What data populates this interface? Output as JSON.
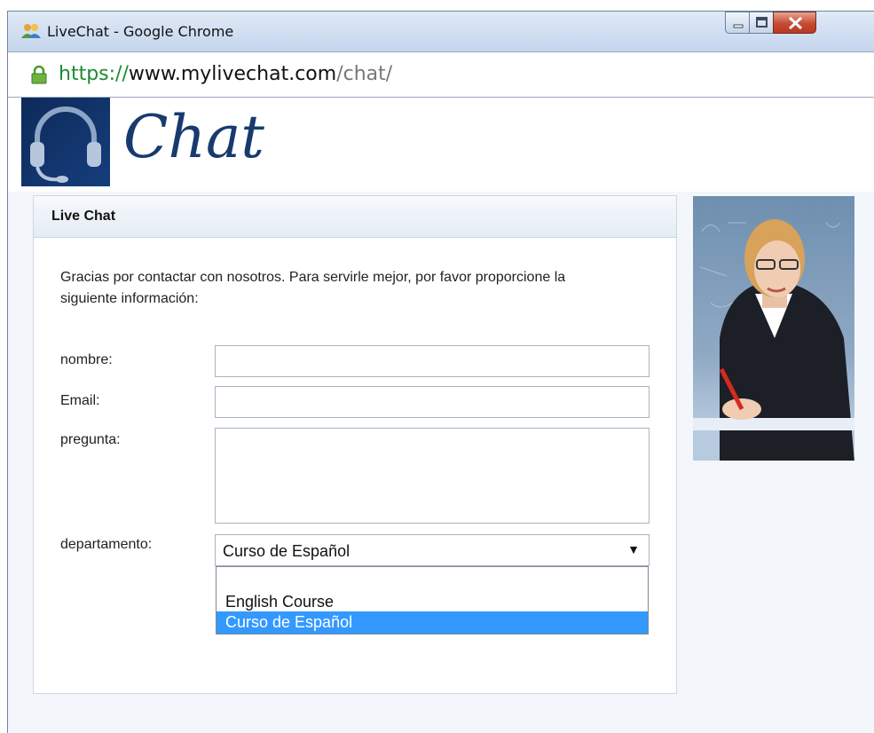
{
  "window": {
    "title": "LiveChat - Google Chrome"
  },
  "address_bar": {
    "scheme": "https",
    "separator": "://",
    "host": "www.mylivechat.com",
    "path": "/chat/"
  },
  "banner": {
    "brand": "Chat"
  },
  "panel": {
    "title": "Live Chat",
    "intro": "Gracias por contactar con nosotros. Para servirle mejor, por favor proporcione la siguiente información:",
    "fields": {
      "name_label": "nombre:",
      "name_value": "",
      "email_label": "Email:",
      "email_value": "",
      "question_label": "pregunta:",
      "question_value": "",
      "department_label": "departamento:",
      "department_value": "Curso de Español"
    },
    "department_options": [
      "",
      "English Course",
      "Curso de Español"
    ],
    "selected_option": "Curso de Español"
  },
  "colors": {
    "selection": "#3399ff",
    "brand_blue": "#183a6e",
    "url_green": "#1a8c31"
  }
}
